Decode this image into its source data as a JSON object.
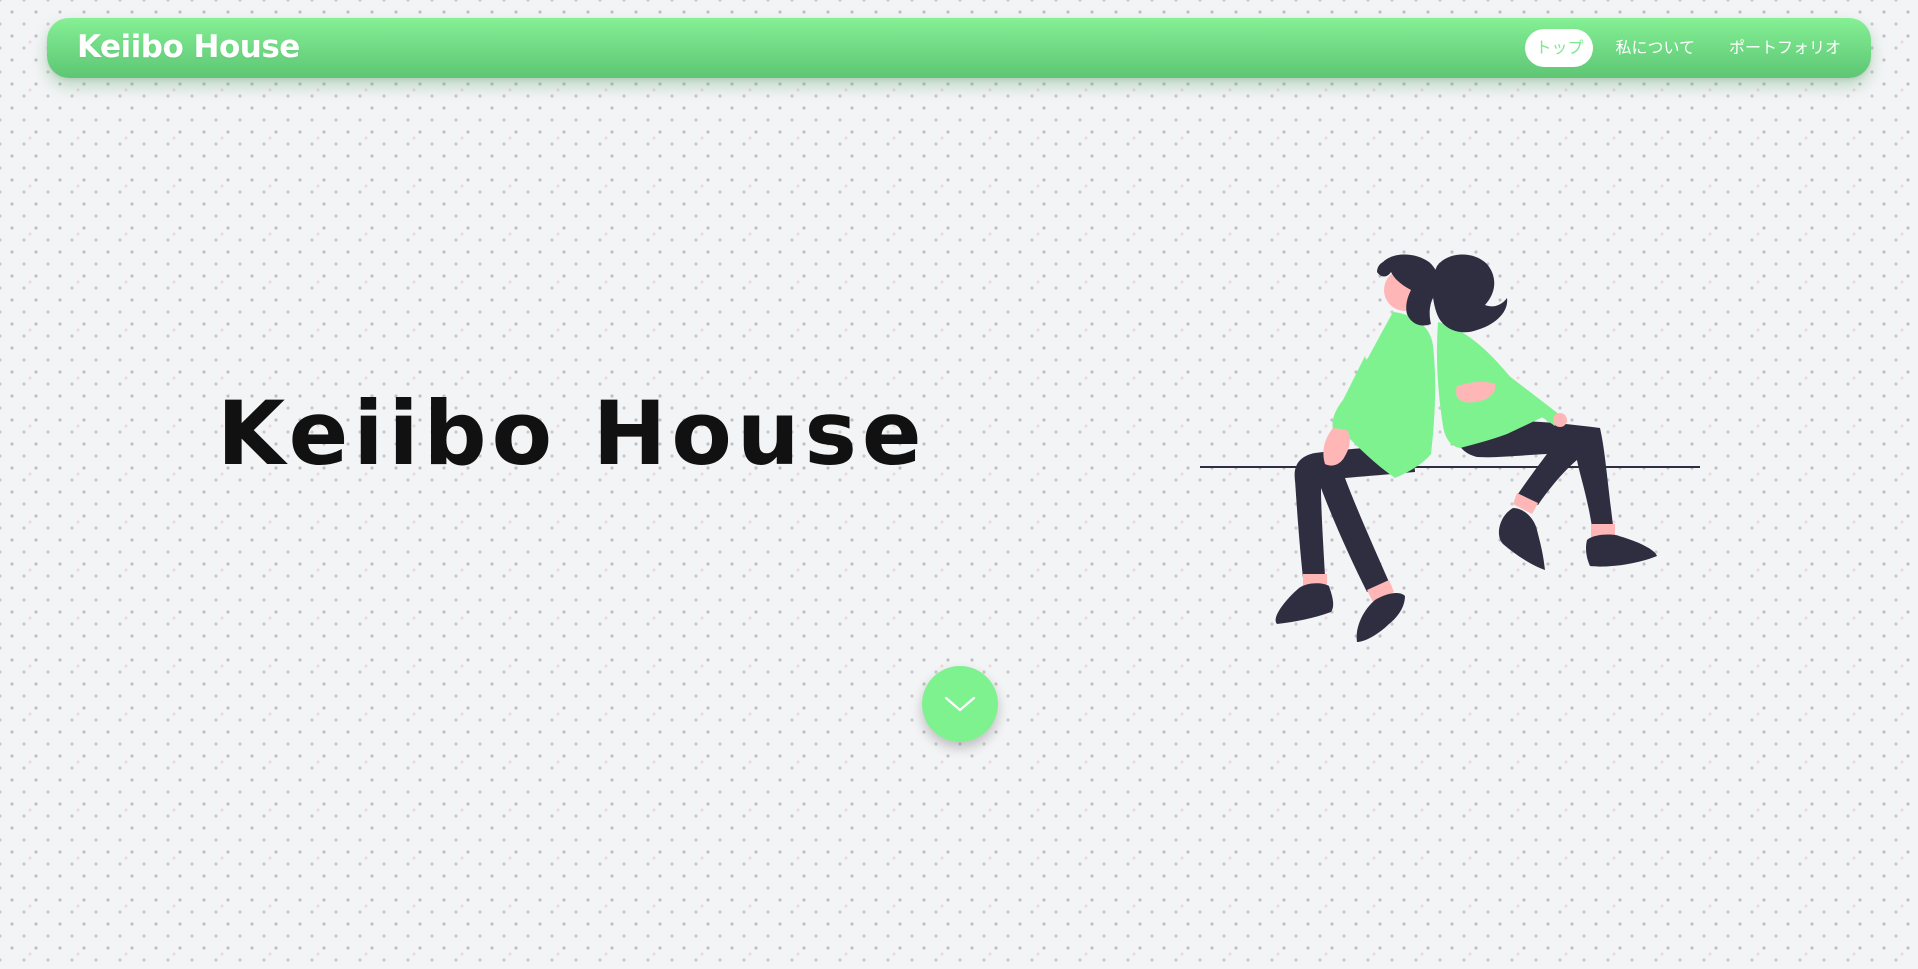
{
  "header": {
    "brand": "Keiibo House",
    "nav": [
      {
        "label": "トップ",
        "active": true
      },
      {
        "label": "私について",
        "active": false
      },
      {
        "label": "ポートフォリオ",
        "active": false
      }
    ]
  },
  "hero": {
    "title": "Keiibo House"
  },
  "scroll_button": {
    "icon": "chevron-down-icon"
  },
  "colors": {
    "accent": "#7ee88f",
    "header_gradient_top": "#86f095",
    "header_gradient_bottom": "#5fc674",
    "title_text": "#111111",
    "background": "#f3f4f6"
  }
}
